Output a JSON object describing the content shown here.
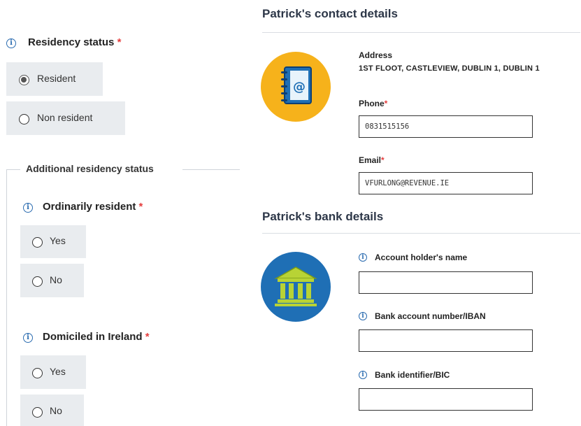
{
  "residency": {
    "label": "Residency status",
    "required_mark": "*",
    "options": [
      "Resident",
      "Non resident"
    ],
    "selected": "Resident"
  },
  "additional": {
    "legend": "Additional residency status",
    "ordinarily": {
      "label": "Ordinarily resident",
      "required_mark": "*",
      "options": [
        "Yes",
        "No"
      ]
    },
    "domiciled": {
      "label": "Domiciled in Ireland",
      "required_mark": "*",
      "options": [
        "Yes",
        "No"
      ]
    }
  },
  "contact": {
    "title": "Patrick's contact details",
    "address_label": "Address",
    "address_value": "1ST FLOOT, CASTLEVIEW, DUBLIN 1, DUBLIN 1",
    "phone_label": "Phone",
    "phone_required": "*",
    "phone_value": "0831515156",
    "email_label": "Email",
    "email_required": "*",
    "email_value": "VFURLONG@REVENUE.IE"
  },
  "bank": {
    "title": "Patrick's bank details",
    "holder_label": "Account holder's name",
    "holder_value": "",
    "iban_label": "Bank account number/IBAN",
    "iban_value": "",
    "bic_label": "Bank identifier/BIC",
    "bic_value": ""
  },
  "icons": {
    "info": "info-icon",
    "contact_book": "address-book-icon",
    "bank": "bank-icon"
  },
  "colors": {
    "contact_circle": "#f6b21b",
    "bank_circle": "#1f6fb5",
    "info_blue": "#2b6cb0",
    "required_red": "#e53e3e",
    "option_bg": "#e9ecef"
  }
}
